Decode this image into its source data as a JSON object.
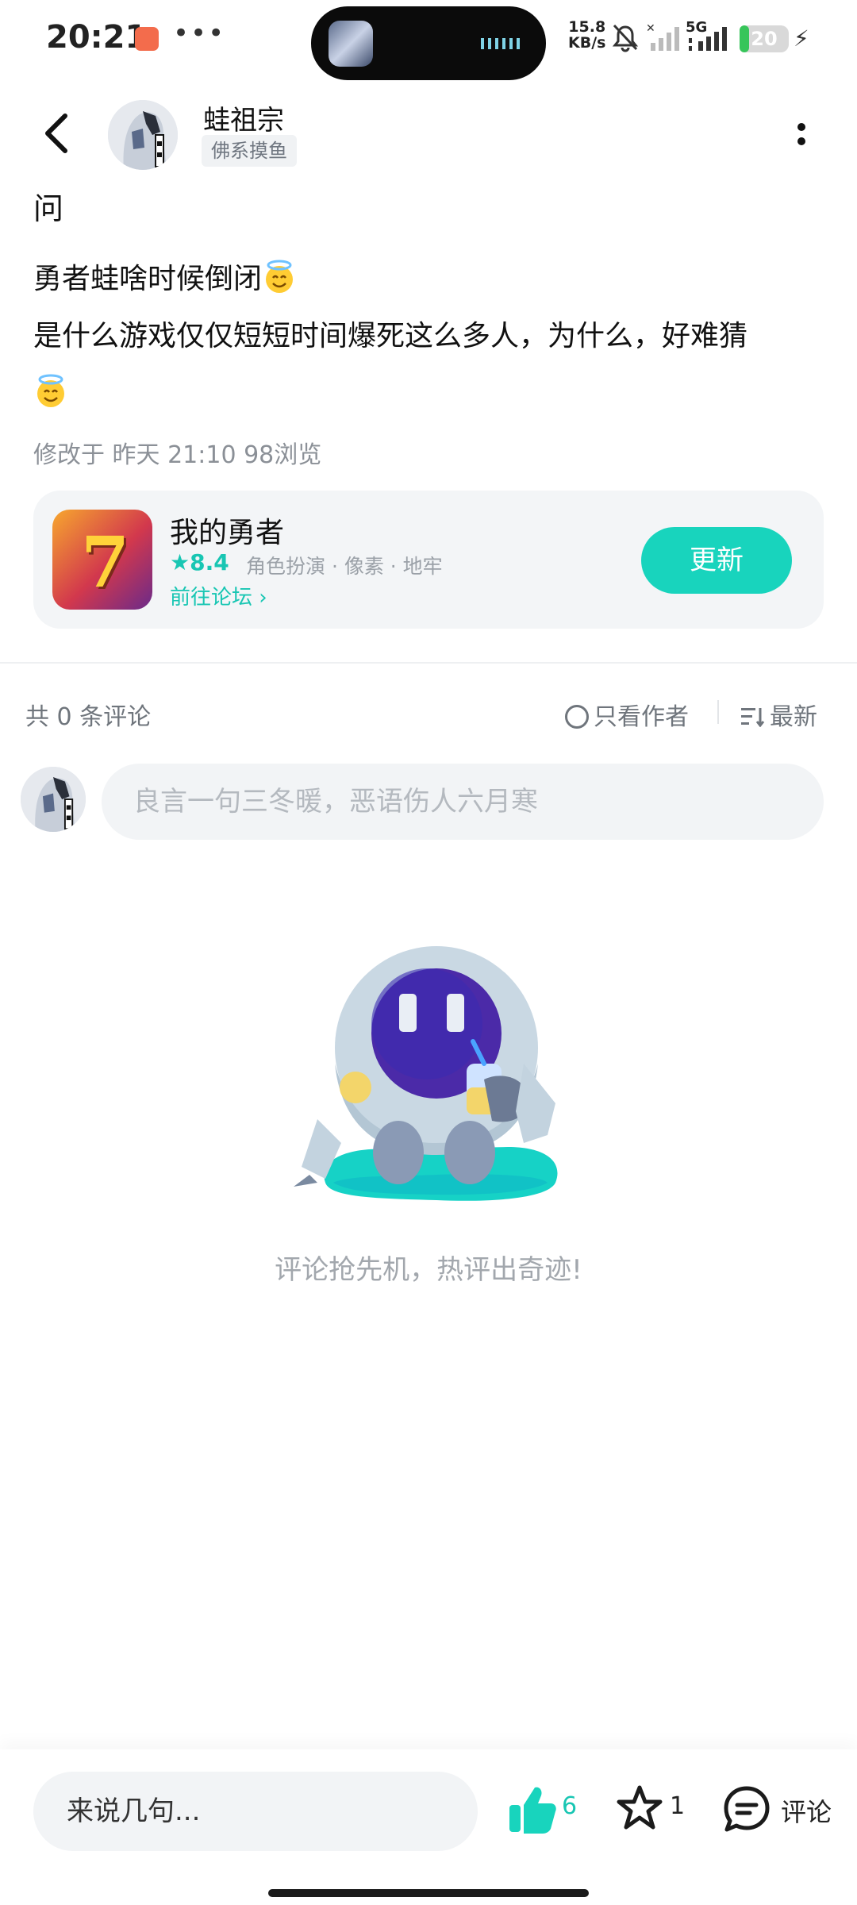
{
  "status_bar": {
    "time": "20:21",
    "more_dots": "•••",
    "net_speed_value": "15.8",
    "net_speed_unit": "KB/s",
    "network_type": "5G",
    "battery_level": "20",
    "battery_fraction": 0.2,
    "icons": [
      "mute-icon",
      "signal-icon",
      "battery-icon",
      "charging-icon"
    ]
  },
  "header": {
    "username": "蛙祖宗",
    "user_tag": "佛系摸鱼"
  },
  "post": {
    "title": "问",
    "line1": "勇者蛙啥时候倒闭",
    "line2": "是什么游戏仅仅短短时间爆死这么多人，为什么，好难猜",
    "meta": "修改于 昨天 21:10  98浏览"
  },
  "game_card": {
    "name": "我的勇者",
    "rating": "8.4",
    "tags": "角色扮演 · 像素 · 地牢",
    "forum_link": "前往论坛",
    "button": "更新"
  },
  "comments": {
    "count_text": "共 0 条评论",
    "only_author": "只看作者",
    "sort": "最新",
    "input_placeholder": "良言一句三冬暖，恶语伤人六月寒",
    "empty_text": "评论抢先机，热评出奇迹!"
  },
  "bottom_bar": {
    "say_placeholder": "来说几句...",
    "likes": "6",
    "favorites": "1",
    "comment_label": "评论"
  },
  "colors": {
    "accent": "#18d4bd",
    "accent_text": "#18c6b3",
    "battery_green": "#37c55a"
  }
}
